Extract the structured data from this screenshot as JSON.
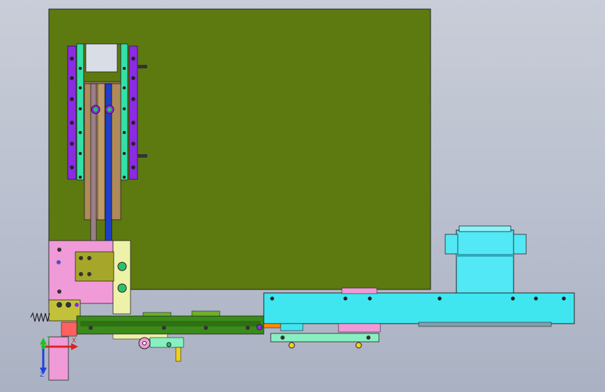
{
  "viewport": {
    "background_top": "#c9cdd8",
    "background_bottom": "#aab1c2"
  },
  "model": {
    "main_plate_color": "#5d7a10",
    "rail_purple": "#8b2be2",
    "rail_cyan": "#33e0a8",
    "slider_brown": "#b08a5a",
    "rod_blue": "#1f3fc8",
    "base_cyan": "#3fe6f0",
    "cylinder_cyan": "#52e8f5",
    "pink_block": "#f09ad8",
    "olive_block": "#a6a62a",
    "light_yellow": "#eef2a8",
    "green_bar": "#3b8a1a",
    "mint_bracket": "#88f0c0"
  },
  "triad": {
    "x_label": "X",
    "y_label": "Y",
    "z_label": "Z",
    "x_color": "#e02020",
    "y_color": "#20c020",
    "z_color": "#2040e0"
  }
}
